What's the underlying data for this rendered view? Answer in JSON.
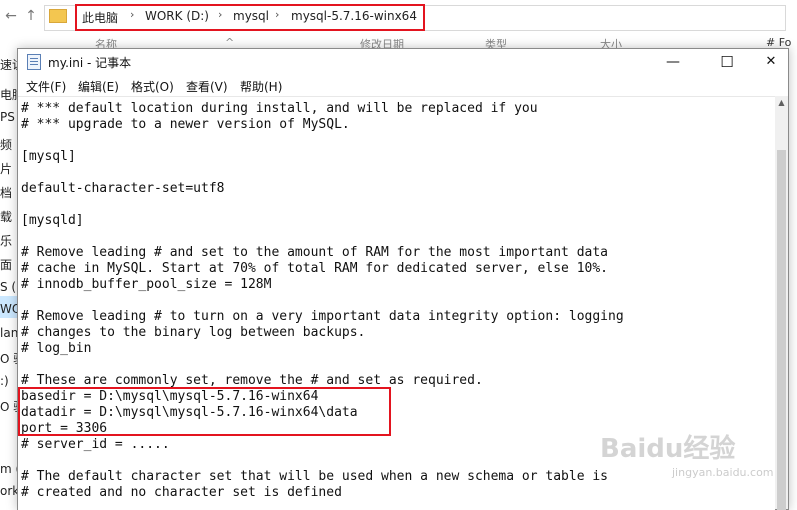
{
  "explorer": {
    "breadcrumb": [
      "此电脑",
      "WORK (D:)",
      "mysql",
      "mysql-5.7.16-winx64"
    ],
    "left_pane_items": [
      "速访",
      "电脑",
      "PS",
      "频",
      "片",
      "档",
      "载",
      "乐",
      "面",
      "S (",
      "WOR",
      "lan",
      "O 驱",
      ":)",
      "O 驱",
      "m (",
      "ork"
    ],
    "columns": [
      "名称",
      "修改日期",
      "类型",
      "大小",
      "# Fo"
    ],
    "right_strip_text": "# Fo"
  },
  "notepad": {
    "title": "my.ini - 记事本",
    "controls": {
      "minimize": "—",
      "maximize": "☐",
      "close": "✕"
    },
    "menu": [
      "文件(F)",
      "编辑(E)",
      "格式(O)",
      "查看(V)",
      "帮助(H)"
    ],
    "lines": [
      "# *** default location during install, and will be replaced if you",
      "# *** upgrade to a newer version of MySQL.",
      "",
      "[mysql]",
      "",
      "default-character-set=utf8",
      "",
      "[mysqld]",
      "",
      "# Remove leading # and set to the amount of RAM for the most important data",
      "# cache in MySQL. Start at 70% of total RAM for dedicated server, else 10%.",
      "# innodb_buffer_pool_size = 128M",
      "",
      "# Remove leading # to turn on a very important data integrity option: logging",
      "# changes to the binary log between backups.",
      "# log_bin",
      "",
      "# These are commonly set, remove the # and set as required.",
      "basedir = D:\\mysql\\mysql-5.7.16-winx64",
      "datadir = D:\\mysql\\mysql-5.7.16-winx64\\data",
      "port = 3306",
      "# server_id = .....",
      "",
      "# The default character set that will be used when a new schema or table is",
      "# created and no character set is defined"
    ]
  },
  "watermark": {
    "main": "Baidu经验",
    "sub": "jingyan.baidu.com"
  },
  "colors": {
    "highlight_box": "#e3141f",
    "selection": "#cce8ff"
  }
}
